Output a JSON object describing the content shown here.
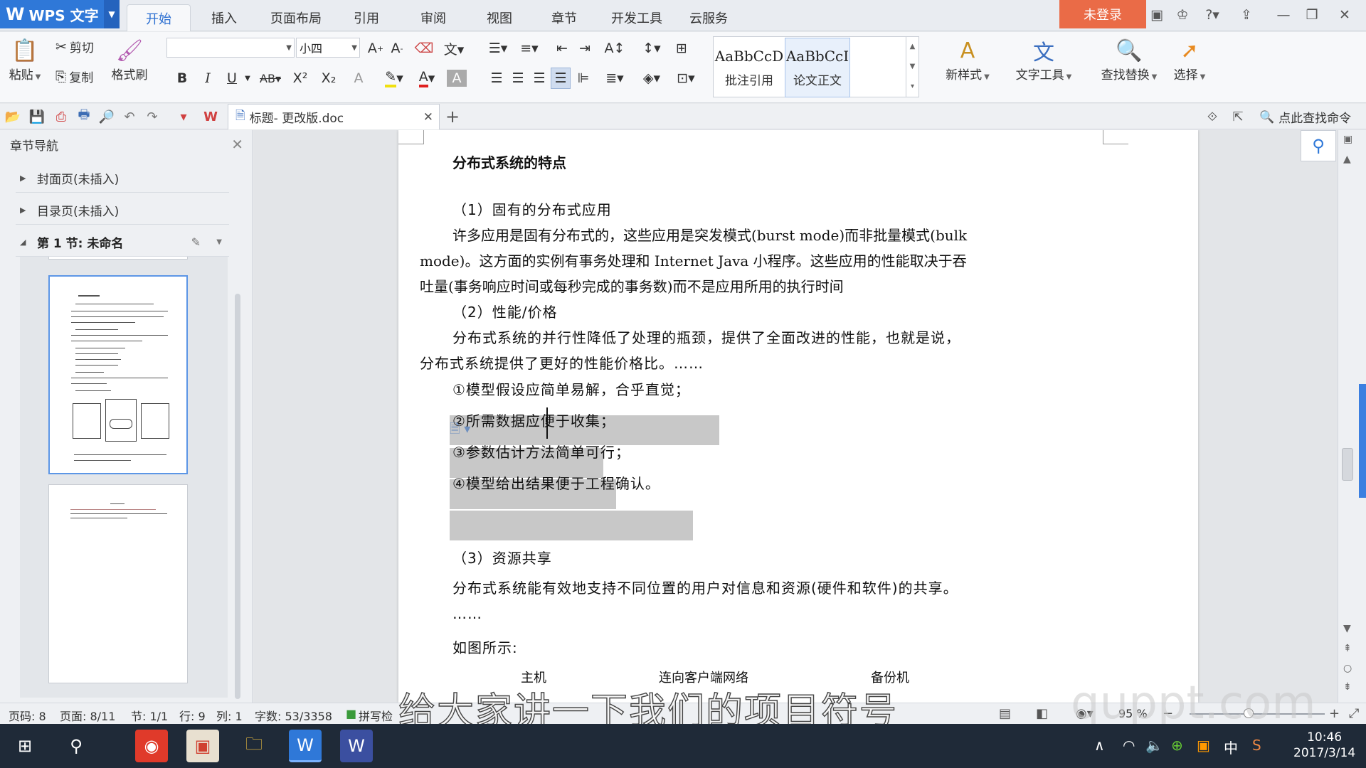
{
  "app": {
    "logo": "WPS 文字",
    "login": "未登录"
  },
  "menu": {
    "tabs": [
      "开始",
      "插入",
      "页面布局",
      "引用",
      "审阅",
      "视图",
      "章节",
      "开发工具",
      "云服务"
    ],
    "active": "开始"
  },
  "ribbon": {
    "paste": "粘贴",
    "cut": "剪切",
    "copy": "复制",
    "format_painter": "格式刷",
    "font_name": "",
    "font_size": "小四",
    "bold": "B",
    "italic": "I",
    "underline": "U",
    "styles": [
      {
        "preview": "AaBbCcD",
        "label": "批注引用"
      },
      {
        "preview": "AaBbCcI",
        "label": "论文正文"
      }
    ],
    "new_style": "新样式",
    "text_tools": "文字工具",
    "find_replace": "查找替换",
    "select": "选择"
  },
  "quickbar": {
    "doc_tab": "标题- 更改版.doc",
    "command_search": "点此查找命令"
  },
  "nav": {
    "title": "章节导航",
    "items": [
      "封面页(未插入)",
      "目录页(未插入)",
      "第 1 节: 未命名"
    ]
  },
  "document": {
    "heading": "分布式系统的特点",
    "s1": "（1）固有的分布式应用",
    "p1_l1": "许多应用是固有分布式的，这些应用是突发模式(burst mode)而非批量模式(bulk",
    "p1_l2": "mode)。这方面的实例有事务处理和 Internet Java 小程序。这些应用的性能取决于吞",
    "p1_l3": "吐量(事务响应时间或每秒完成的事务数)而不是应用所用的执行时间",
    "s2": "（2）性能/价格",
    "p2_l1": "分布式系统的并行性降低了处理的瓶颈，提供了全面改进的性能，也就是说，",
    "p2_l2": "分布式系统提供了更好的性能价格比。……",
    "bullets": [
      "①模型假设应简单易解，合乎直觉；",
      "②所需数据应便于收集；",
      "③参数估计方法简单可行；",
      "④模型给出结果便于工程确认。"
    ],
    "s3": "（3）资源共享",
    "p3": "分布式系统能有效地支持不同位置的用户对信息和资源(硬件和软件)的共享。",
    "ellipsis": "……",
    "figure_intro": "如图所示:",
    "diagram_labels": [
      "主机",
      "连向客户端网络",
      "备份机"
    ]
  },
  "status": {
    "page_code": "页码: 8",
    "page": "页面: 8/11",
    "section": "节: 1/1",
    "row": "行: 9",
    "col": "列: 1",
    "words": "字数: 53/3358",
    "spell": "拼写检",
    "zoom": "95 %"
  },
  "overlay": {
    "subtitle": "给大家讲一下我们的项目符号",
    "watermark": "quppt.com"
  },
  "taskbar": {
    "time": "10:46",
    "date": "2017/3/14",
    "ime": "中"
  }
}
